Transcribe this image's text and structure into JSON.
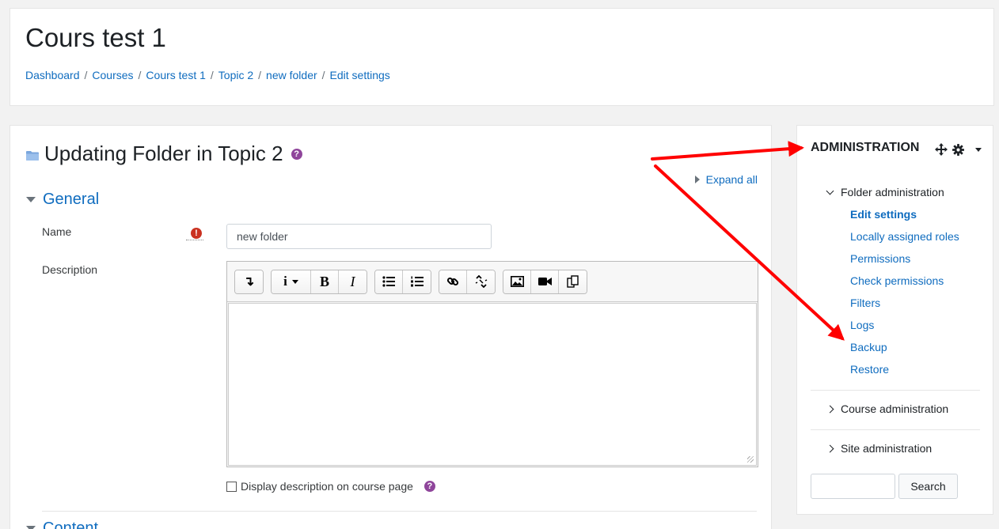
{
  "header": {
    "course_title": "Cours test 1",
    "breadcrumb": [
      "Dashboard",
      "Courses",
      "Cours test 1",
      "Topic 2",
      "new folder",
      "Edit settings"
    ],
    "separator": "/"
  },
  "form": {
    "title": "Updating Folder in Topic 2",
    "help_glyph": "?",
    "expand_all": "Expand all",
    "general_section": "General",
    "name_label": "Name",
    "required_glyph": "!",
    "name_value": "new folder",
    "description_label": "Description",
    "display_description_label": "Display description on course page",
    "content_section": "Content"
  },
  "editor": {
    "toolbar": {
      "collapse_glyph": "↴",
      "paragraph_glyph": "i",
      "bold_glyph": "B",
      "italic_glyph": "I"
    },
    "icons": [
      "collapse-icon",
      "paragraph-style-icon",
      "bold-icon",
      "italic-icon",
      "unordered-list-icon",
      "ordered-list-icon",
      "link-icon",
      "unlink-icon",
      "image-icon",
      "media-icon",
      "manage-files-icon"
    ]
  },
  "admin": {
    "title": "ADMINISTRATION",
    "folder_admin": "Folder administration",
    "links": [
      "Edit settings",
      "Locally assigned roles",
      "Permissions",
      "Check permissions",
      "Filters",
      "Logs",
      "Backup",
      "Restore"
    ],
    "active_link": "Edit settings",
    "course_admin": "Course administration",
    "site_admin": "Site administration",
    "search_button": "Search"
  },
  "colors": {
    "link": "#0f6cbf",
    "help": "#8f459b",
    "required": "#ca3120",
    "annotation_arrow": "#ff0000"
  }
}
